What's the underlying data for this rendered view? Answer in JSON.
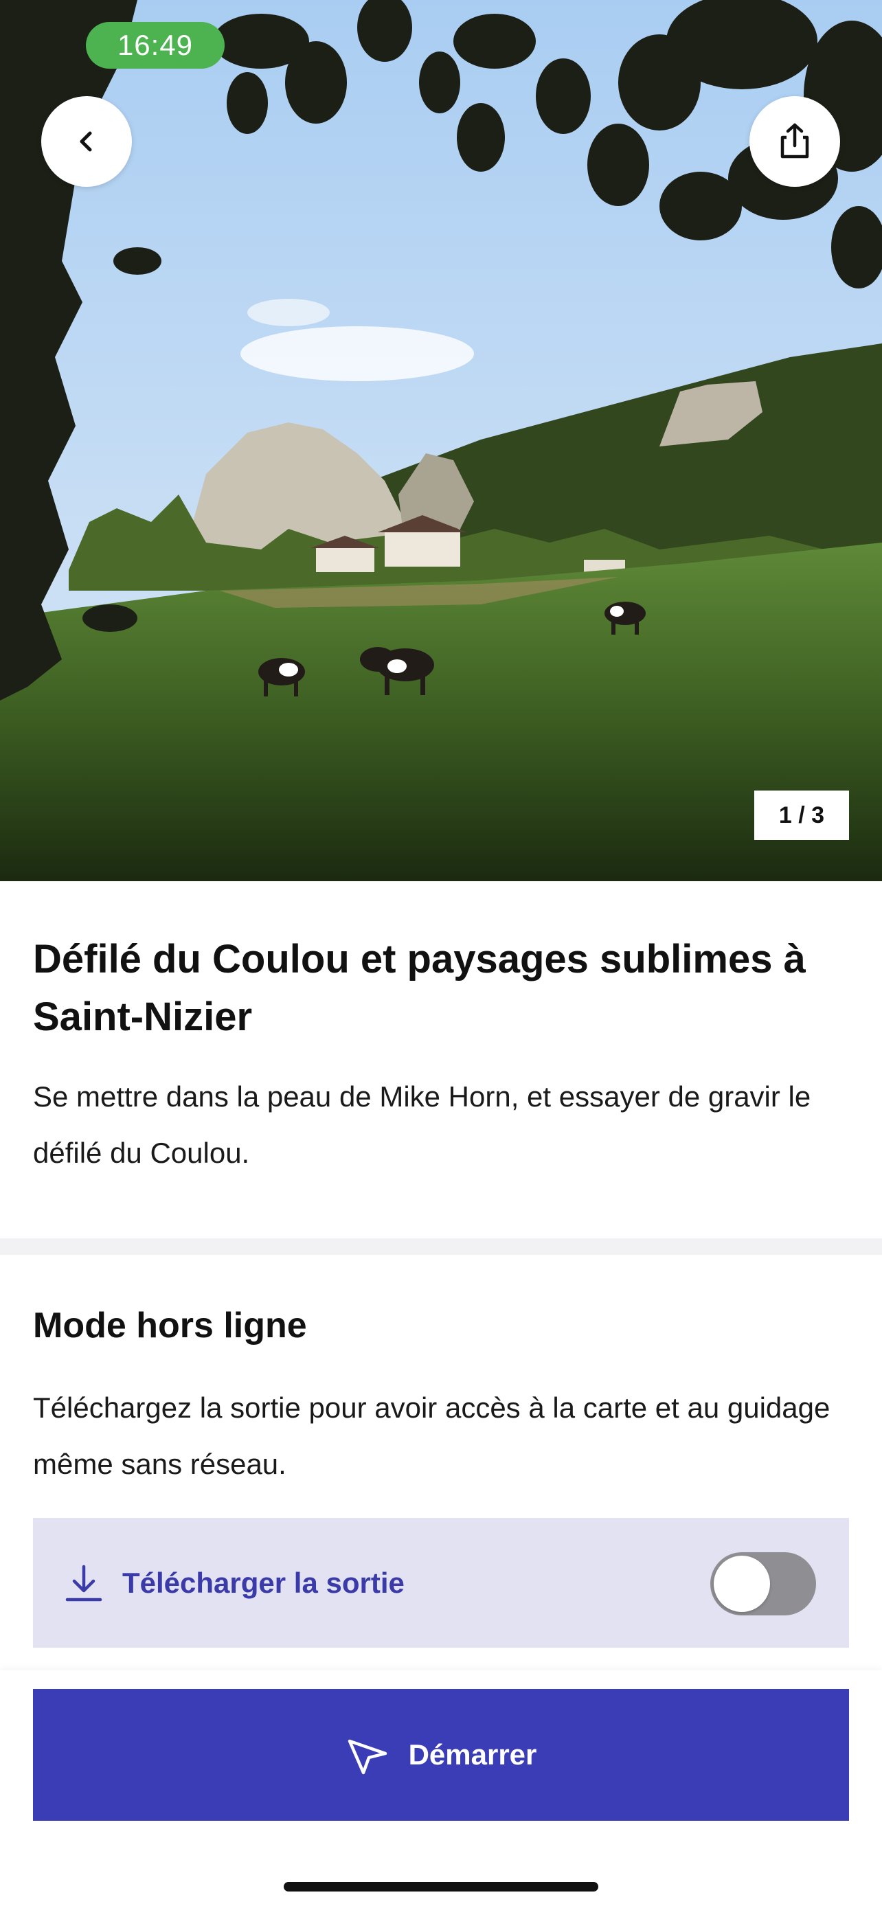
{
  "status_bar": {
    "time": "16:49"
  },
  "hero": {
    "image_alt": "Prairie avec vaches et falaises",
    "counter": "1 / 3"
  },
  "route": {
    "title": "Défilé du Coulou et paysages sublimes à Saint-Nizier",
    "description": "Se mettre dans la peau de Mike Horn, et essayer de gravir le défilé du Coulou."
  },
  "offline": {
    "title": "Mode hors ligne",
    "text": "Téléchargez la sortie pour avoir accès à la carte et au guidage même sans réseau.",
    "download_label": "Télécharger la sortie",
    "toggle_on": false
  },
  "actions": {
    "start_label": "Démarrer"
  },
  "icons": {
    "back": "chevron-left-icon",
    "share": "share-icon",
    "download": "download-icon",
    "start": "navigation-arrow-icon"
  },
  "colors": {
    "accent": "#3a3db5",
    "accent_light": "#e2e2f2",
    "clock_bg": "#4cb350",
    "toggle_off": "#8f8f93"
  }
}
